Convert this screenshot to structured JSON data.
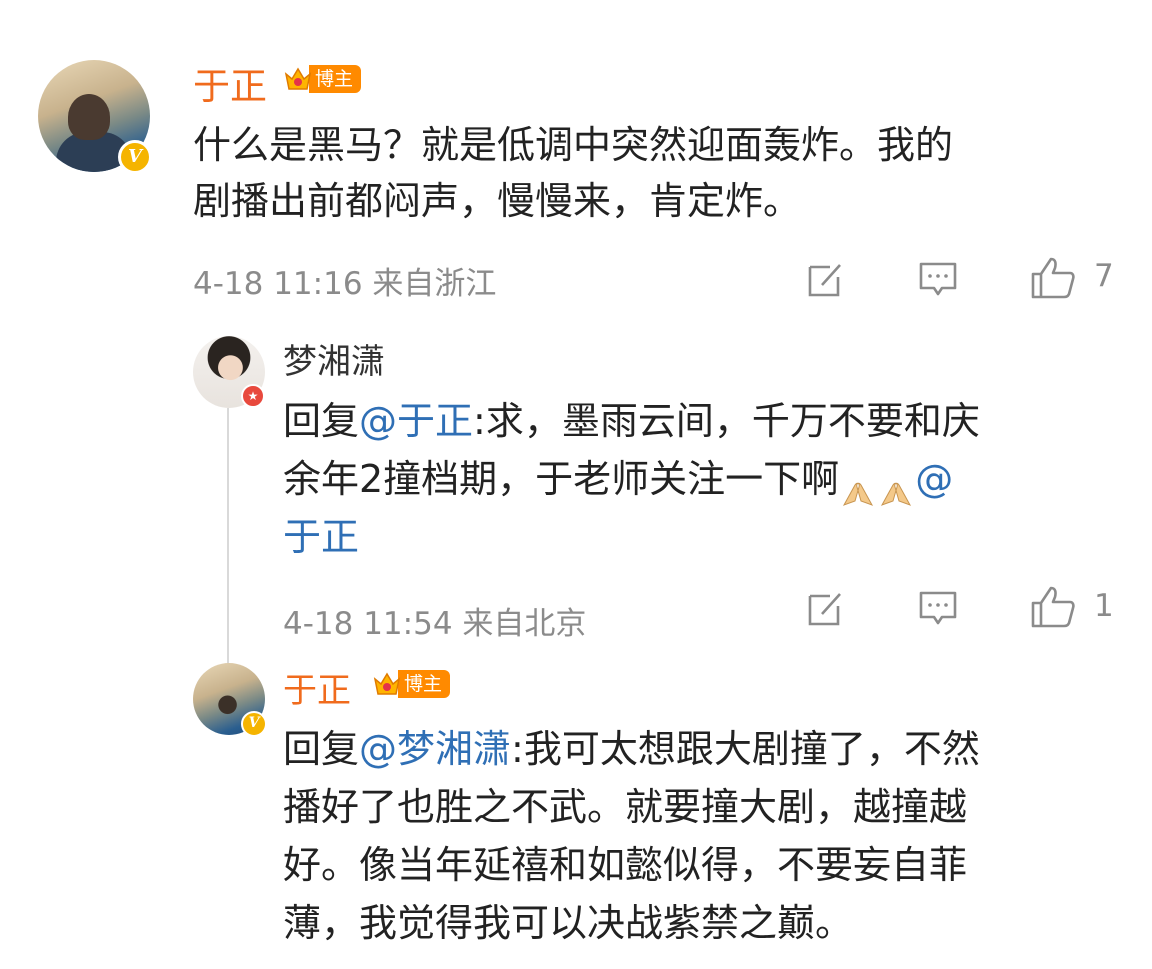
{
  "post": {
    "author": "于正",
    "badge": "博主",
    "text_lines": [
      "什么是黑马？就是低调中突然迎面轰炸。我的",
      "剧播出前都闷声，慢慢来，肯定炸。"
    ],
    "meta": "4-18 11:16 来自浙江",
    "like_count": "7"
  },
  "reply1": {
    "author": "梦湘潇",
    "line1_prefix": "回复",
    "line1_mention": "@于正",
    "line1_rest": ":求，墨雨云间，千万不要和庆",
    "line2": "余年2撞档期，于老师关注一下啊",
    "line2_mention": "@",
    "line3_mention": "于正",
    "meta": "4-18 11:54 来自北京",
    "like_count": "1"
  },
  "reply2": {
    "author": "于正",
    "badge": "博主",
    "line1_prefix": "回复",
    "line1_mention": "@梦湘潇",
    "line1_rest": ":我可太想跟大剧撞了，不然",
    "lines": [
      "播好了也胜之不武。就要撞大剧，越撞越",
      "好。像当年延禧和如懿似得，不要妄自菲",
      "薄，我觉得我可以决战紫禁之巅。"
    ]
  },
  "icons": [
    "edit-icon",
    "comment-icon",
    "like-icon",
    "verified-v-icon",
    "crown-icon",
    "pray-emoji-icon"
  ],
  "colors": {
    "name": "#f06b1d",
    "mention": "#2f6fb5",
    "meta": "#8b8b8b",
    "badge": "#ff8a00",
    "verified": "#f5b400"
  }
}
